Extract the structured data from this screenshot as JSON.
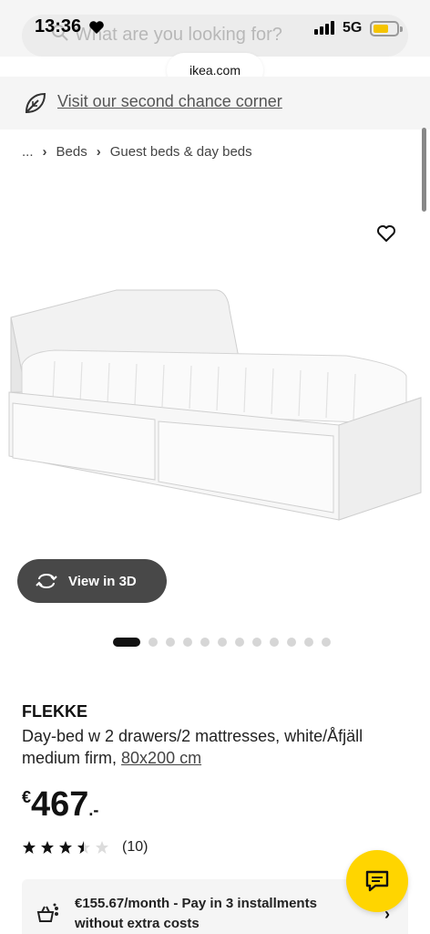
{
  "status_bar": {
    "time": "13:36",
    "network": "5G"
  },
  "search": {
    "placeholder": "What are you looking for?"
  },
  "browser": {
    "url": "ikea.com"
  },
  "promo": {
    "link_text": "Visit our second chance corner"
  },
  "breadcrumb": {
    "ellipsis": "...",
    "items": [
      "Beds",
      "Guest beds & day beds"
    ]
  },
  "gallery": {
    "view3d_label": "View in 3D",
    "image_count": 12,
    "active_index": 0
  },
  "product": {
    "name": "FLEKKE",
    "description": "Day-bed w 2 drawers/2 mattresses, white/Åfjäll medium firm,",
    "size": "80x200 cm",
    "price": {
      "currency": "€",
      "amount": "467",
      "decimals": ".-"
    },
    "rating": {
      "stars": 3.5,
      "max": 5,
      "count": "(10)"
    }
  },
  "installment": {
    "text": "€155.67/month - Pay in 3 installments without extra costs"
  },
  "colors": {
    "accent_yellow": "#ffd500",
    "dark_button": "#484848",
    "text": "#111111"
  },
  "icons": [
    "search-icon",
    "heart-icon",
    "leaf-icon",
    "rotate-3d-icon",
    "star-icon",
    "installment-icon",
    "chevron-right-icon",
    "chat-icon",
    "signal-icon",
    "battery-icon"
  ]
}
